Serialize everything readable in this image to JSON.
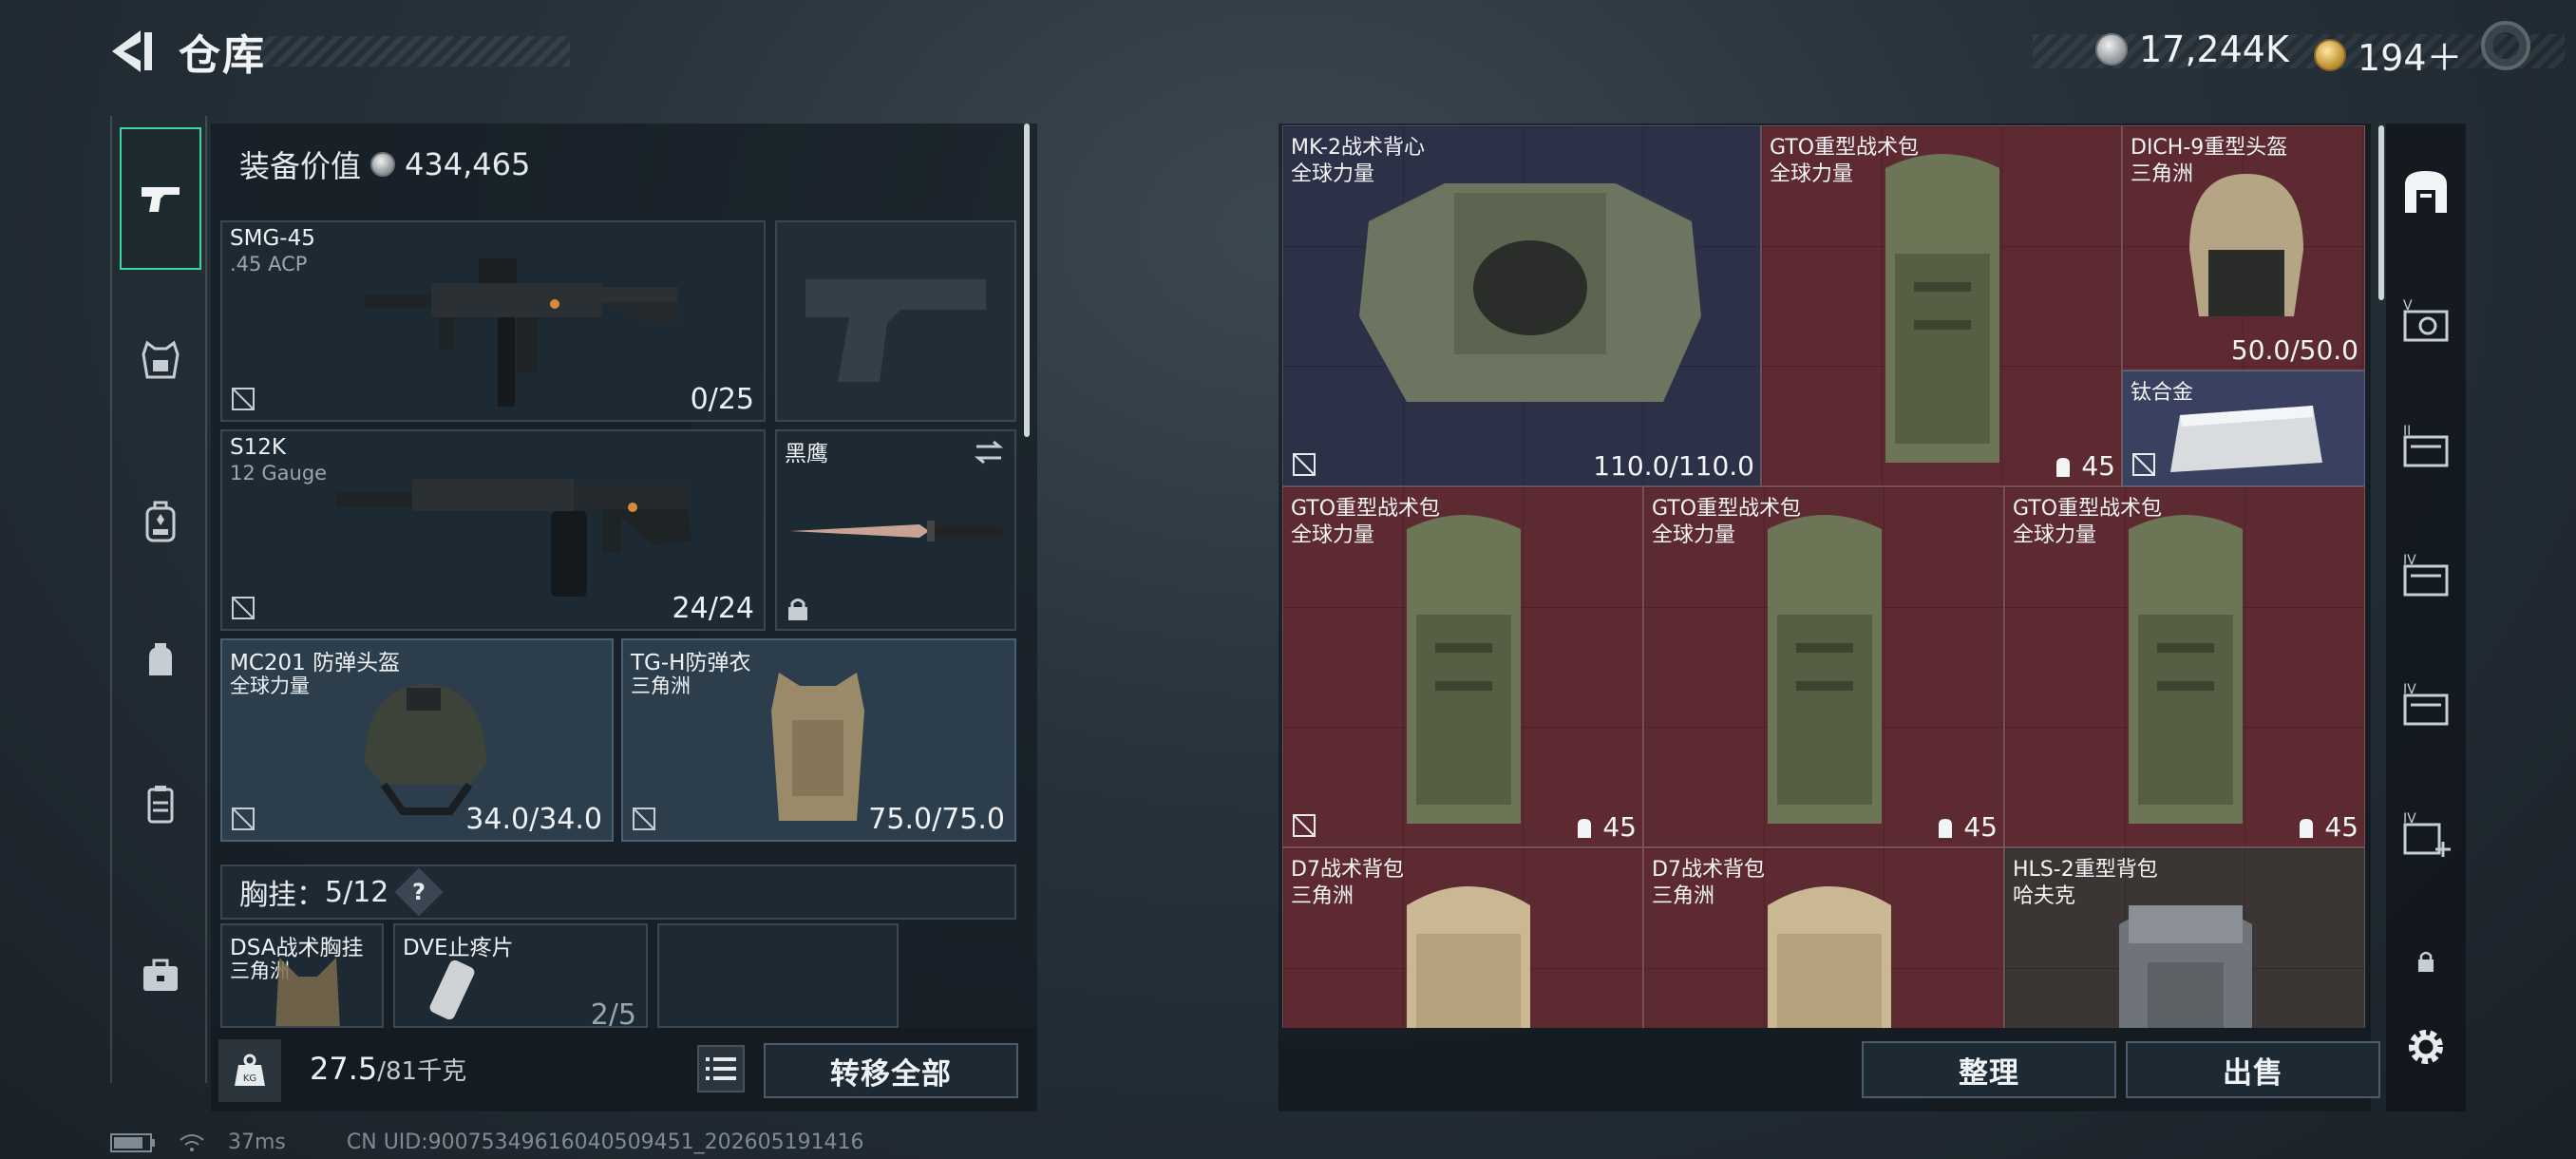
{
  "header": {
    "title": "仓库",
    "currency_silver": "17,244K",
    "currency_gold": "194＋"
  },
  "left_rail": {
    "tabs": [
      "weapon-icon",
      "vest-icon",
      "backpack-icon",
      "rig-icon",
      "pouch-icon",
      "case-icon"
    ],
    "active": "weapon-icon"
  },
  "equipment": {
    "value_label": "装备价值",
    "value": "434,465",
    "primary": {
      "name": "SMG-45",
      "caliber": ".45 ACP",
      "ammo": "0/25"
    },
    "secondary": {
      "name": "S12K",
      "caliber": "12 Gauge",
      "ammo": "24/24"
    },
    "melee": {
      "name": "黑鹰"
    },
    "helmet": {
      "name": "MC201 防弹头盔",
      "faction": "全球力量",
      "durability": "34.0/34.0"
    },
    "armor": {
      "name": "TG-H防弹衣",
      "faction": "三角洲",
      "durability": "75.0/75.0"
    },
    "chest_rig": {
      "label": "胸挂：",
      "count": "5/12",
      "help": "?"
    },
    "rig_items": [
      {
        "name": "DSA战术胸挂",
        "faction": "三角洲"
      },
      {
        "name": "DVE止疼片",
        "count": "2/5"
      }
    ]
  },
  "footer": {
    "weight": "27.5",
    "weight_max": "/81千克",
    "transfer_all": "转移全部",
    "sort": "整理",
    "sell": "出售"
  },
  "status": {
    "ping": "37ms",
    "uid": "CN UID:900753496160405094​51_202605191416"
  },
  "storage": [
    {
      "name": "MK-2战术背心",
      "faction": "全球力量",
      "value": "110.0/110.0"
    },
    {
      "name": "GTO重型战术包",
      "faction": "全球力量",
      "capacity": "45"
    },
    {
      "name": "DICH-9重型头盔",
      "faction": "三角洲",
      "value": "50.0/50.0"
    },
    {
      "name": "钛合金"
    },
    {
      "name": "GTO重型战术包",
      "faction": "全球力量",
      "capacity": "45"
    },
    {
      "name": "GTO重型战术包",
      "faction": "全球力量",
      "capacity": "45"
    },
    {
      "name": "GTO重型战术包",
      "faction": "全球力量",
      "capacity": "45"
    },
    {
      "name": "D7战术背包",
      "faction": "三角洲"
    },
    {
      "name": "D7战术背包",
      "faction": "三角洲"
    },
    {
      "name": "HLS-2重型背包",
      "faction": "哈夫克"
    }
  ],
  "colors": {
    "accent": "#3fd4a0",
    "rare_red": "#5e2a31",
    "rare_blue": "#2c3148",
    "rare_gray": "#3b3534"
  }
}
